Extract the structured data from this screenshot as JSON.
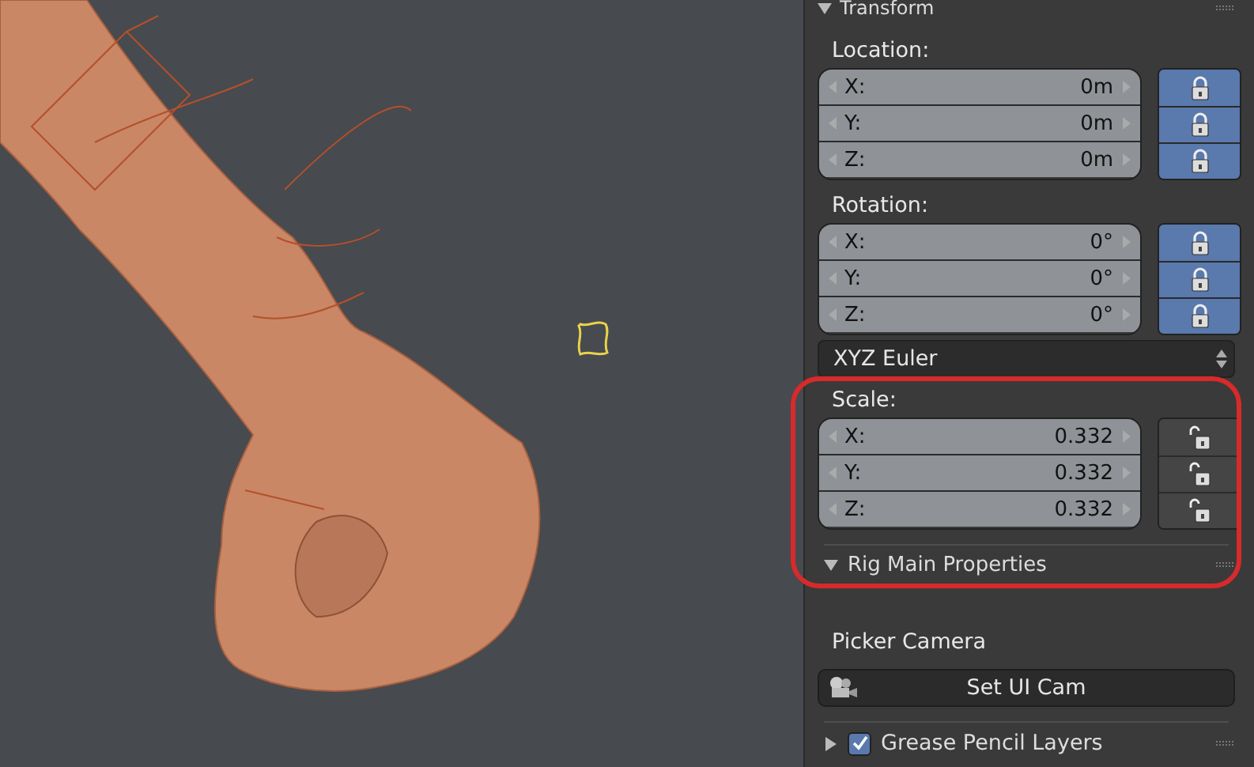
{
  "transform": {
    "title": "Transform",
    "expanded": true,
    "sections": [
      {
        "kind": "vector",
        "label": "Location:",
        "fields": [
          {
            "axis": "X:",
            "value": "0m",
            "locked": true
          },
          {
            "axis": "Y:",
            "value": "0m",
            "locked": true
          },
          {
            "axis": "Z:",
            "value": "0m",
            "locked": true
          }
        ]
      },
      {
        "kind": "vector",
        "label": "Rotation:",
        "fields": [
          {
            "axis": "X:",
            "value": "0°",
            "locked": true
          },
          {
            "axis": "Y:",
            "value": "0°",
            "locked": true
          },
          {
            "axis": "Z:",
            "value": "0°",
            "locked": true
          }
        ]
      },
      {
        "kind": "dropdown",
        "value": "XYZ Euler"
      },
      {
        "kind": "vector",
        "label": "Scale:",
        "fields": [
          {
            "axis": "X:",
            "value": "0.332",
            "locked": false
          },
          {
            "axis": "Y:",
            "value": "0.332",
            "locked": false
          },
          {
            "axis": "Z:",
            "value": "0.332",
            "locked": false
          }
        ]
      }
    ]
  },
  "rig_panel": {
    "title": "Rig Main Properties",
    "expanded": true,
    "label": "Picker Camera",
    "button": "Set UI Cam"
  },
  "grease_pencil": {
    "title": "Grease Pencil Layers",
    "expanded": false,
    "checked": true
  }
}
